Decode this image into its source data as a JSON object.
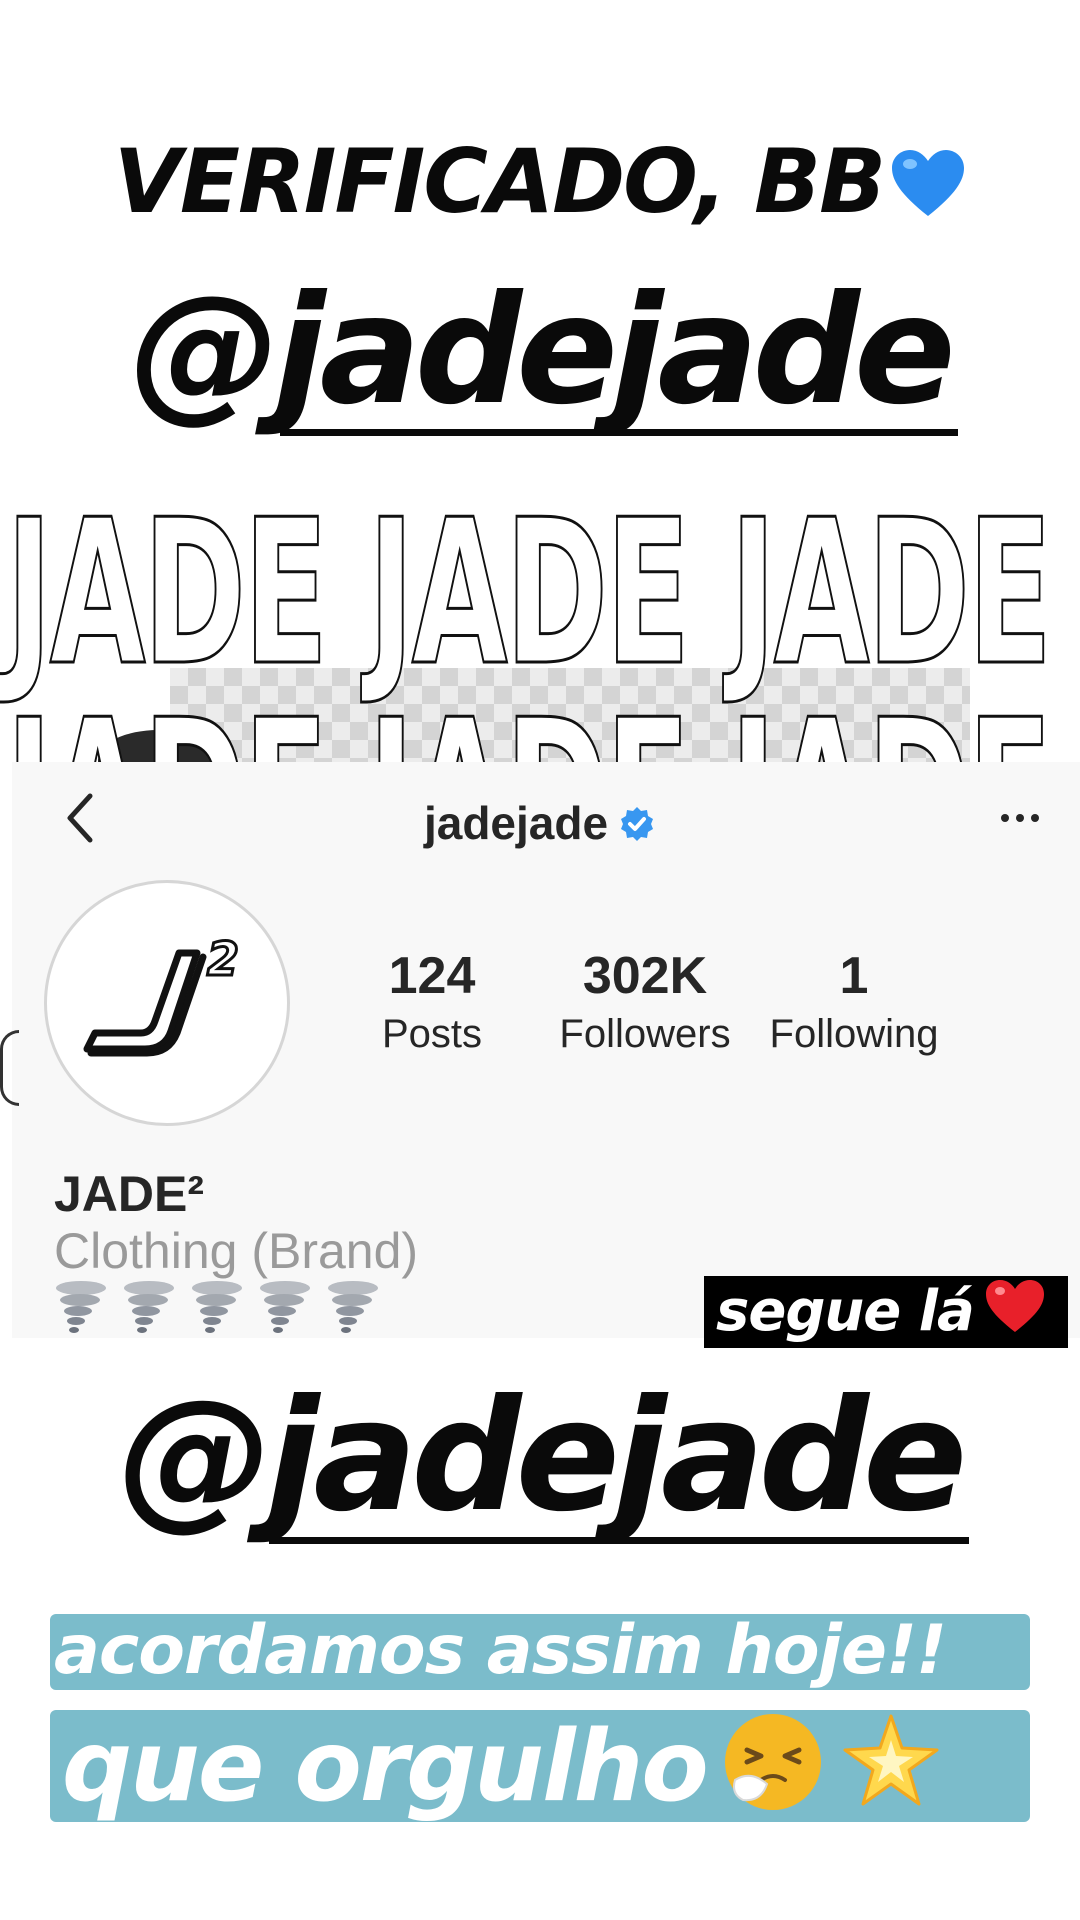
{
  "story": {
    "headline_top": "VERIFICADO, BB",
    "mention_top": "@jadejade",
    "mention_bottom": "@jadejade",
    "graphic_word": "JADE",
    "sticker": "segue lá",
    "banner_line1": "acordamos assim hoje!!",
    "banner_line2": "que orgulho"
  },
  "profile": {
    "username": "jadejade",
    "stats": [
      {
        "value": "124",
        "label": "Posts"
      },
      {
        "value": "302K",
        "label": "Followers"
      },
      {
        "value": "1",
        "label": "Following"
      }
    ],
    "name": "JADE²",
    "category": "Clothing (Brand)",
    "bio_icons": [
      "tornado-icon",
      "tornado-icon",
      "tornado-icon",
      "tornado-icon",
      "tornado-icon"
    ]
  },
  "icons": {
    "heart_blue": "blue-heart-icon",
    "heart_red": "red-heart-icon",
    "verified": "verified-badge-icon",
    "back": "chevron-left-icon",
    "more": "more-dots-icon",
    "sneezing": "sneezing-face-icon",
    "star": "glowing-star-icon"
  },
  "colors": {
    "verified_blue": "#3897f0",
    "banner_blue": "#7bbccb",
    "text_dark": "#0a0a0a",
    "category_gray": "#9a9a9a"
  }
}
